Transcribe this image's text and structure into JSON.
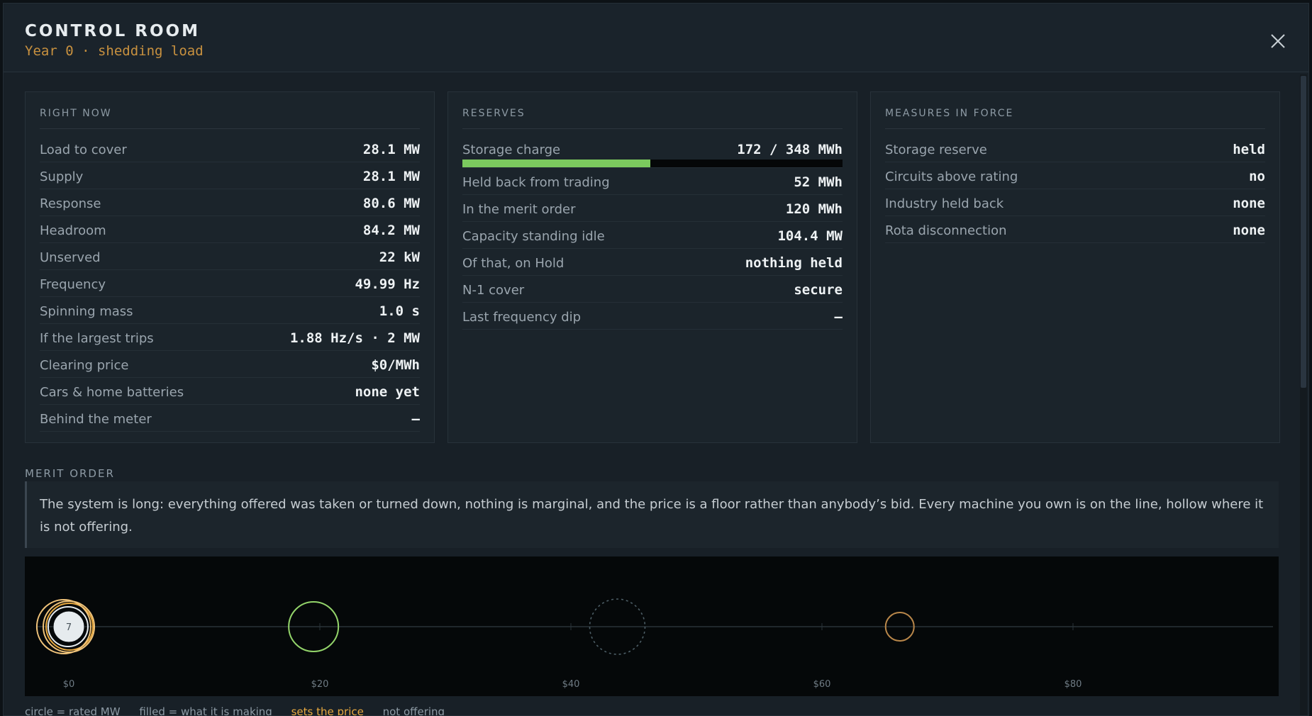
{
  "header": {
    "title": "CONTROL ROOM",
    "subtitle": "Year 0 · shedding load"
  },
  "panels": {
    "right_now": {
      "heading": "RIGHT NOW",
      "rows": [
        {
          "label": "Load to cover",
          "value": "28.1 MW"
        },
        {
          "label": "Supply",
          "value": "28.1 MW"
        },
        {
          "label": "Response",
          "value": "80.6 MW"
        },
        {
          "label": "Headroom",
          "value": "84.2 MW"
        },
        {
          "label": "Unserved",
          "value": "22 kW"
        },
        {
          "label": "Frequency",
          "value": "49.99 Hz"
        },
        {
          "label": "Spinning mass",
          "value": "1.0 s"
        },
        {
          "label": "If the largest trips",
          "value": "1.88 Hz/s · 2 MW"
        },
        {
          "label": "Clearing price",
          "value": "$0/MWh"
        },
        {
          "label": "Cars & home batteries",
          "value": "none yet"
        },
        {
          "label": "Behind the meter",
          "value": "—"
        }
      ]
    },
    "reserves": {
      "heading": "RESERVES",
      "storage": {
        "label": "Storage charge",
        "value": "172 / 348 MWh",
        "fill_fraction": 0.494
      },
      "rows": [
        {
          "label": "Held back from trading",
          "value": "52 MWh"
        },
        {
          "label": "In the merit order",
          "value": "120 MWh"
        },
        {
          "label": "Capacity standing idle",
          "value": "104.4 MW"
        },
        {
          "label": "Of that, on Hold",
          "value": "nothing held"
        },
        {
          "label": "N-1 cover",
          "value": "secure"
        },
        {
          "label": "Last frequency dip",
          "value": "—"
        }
      ]
    },
    "measures": {
      "heading": "MEASURES IN FORCE",
      "rows": [
        {
          "label": "Storage reserve",
          "value": "held"
        },
        {
          "label": "Circuits above rating",
          "value": "no"
        },
        {
          "label": "Industry held back",
          "value": "none"
        },
        {
          "label": "Rota disconnection",
          "value": "none"
        }
      ]
    }
  },
  "merit": {
    "heading": "MERIT ORDER",
    "note": "The system is long: everything offered was taken or turned down, nothing is marginal, and the price is a floor rather than anybody’s bid. Every machine you own is on the line, hollow where it is not offering.",
    "legend": {
      "rated": "circle = rated MW",
      "filled": "filled = what it is making",
      "sets_price": "sets the price",
      "not_offering": "not offering"
    }
  },
  "chart_data": {
    "type": "scatter",
    "x_ticks": [
      "$0",
      "$20",
      "$40",
      "$60",
      "$80"
    ],
    "x_tick_values": [
      0,
      20,
      40,
      60,
      80
    ],
    "xlim": [
      0,
      80
    ],
    "units": [
      {
        "price": 0,
        "rated_r": 36,
        "making_r": 22,
        "stroke": "#f0c37a",
        "fill": "#e6ebee",
        "role": "sets the price",
        "label": "7",
        "dashed": false,
        "inner_ring": true
      },
      {
        "price": 0.06,
        "rated_r": 33,
        "making_r": 0,
        "stroke": "#e8a93f",
        "fill": "none",
        "role": "sets the price",
        "label": "",
        "dashed": false,
        "inner_ring": false
      },
      {
        "price": -0.4,
        "rated_r": 38,
        "making_r": 0,
        "stroke": "#f0c37a",
        "fill": "none",
        "role": "sets the price",
        "label": "",
        "dashed": false,
        "inner_ring": false
      },
      {
        "price": -0.06,
        "rated_r": 28,
        "making_r": 0,
        "stroke": "#e6ebee",
        "fill": "none",
        "role": "",
        "label": "",
        "dashed": false,
        "inner_ring": false
      },
      {
        "price": 19.5,
        "rated_r": 35,
        "making_r": 0,
        "stroke": "#93d46a",
        "fill": "none",
        "role": "",
        "label": "",
        "dashed": false,
        "inner_ring": false
      },
      {
        "price": 43.7,
        "rated_r": 39,
        "making_r": 0,
        "stroke": "#4d5e66",
        "fill": "none",
        "role": "not offering",
        "label": "",
        "dashed": true,
        "inner_ring": false
      },
      {
        "price": 66.2,
        "rated_r": 20,
        "making_r": 0,
        "stroke": "#b9874a",
        "fill": "none",
        "role": "",
        "label": "",
        "dashed": false,
        "inner_ring": false
      }
    ],
    "colors": {
      "axis": "#2a3339",
      "tick_label": "#6f7b84"
    }
  }
}
